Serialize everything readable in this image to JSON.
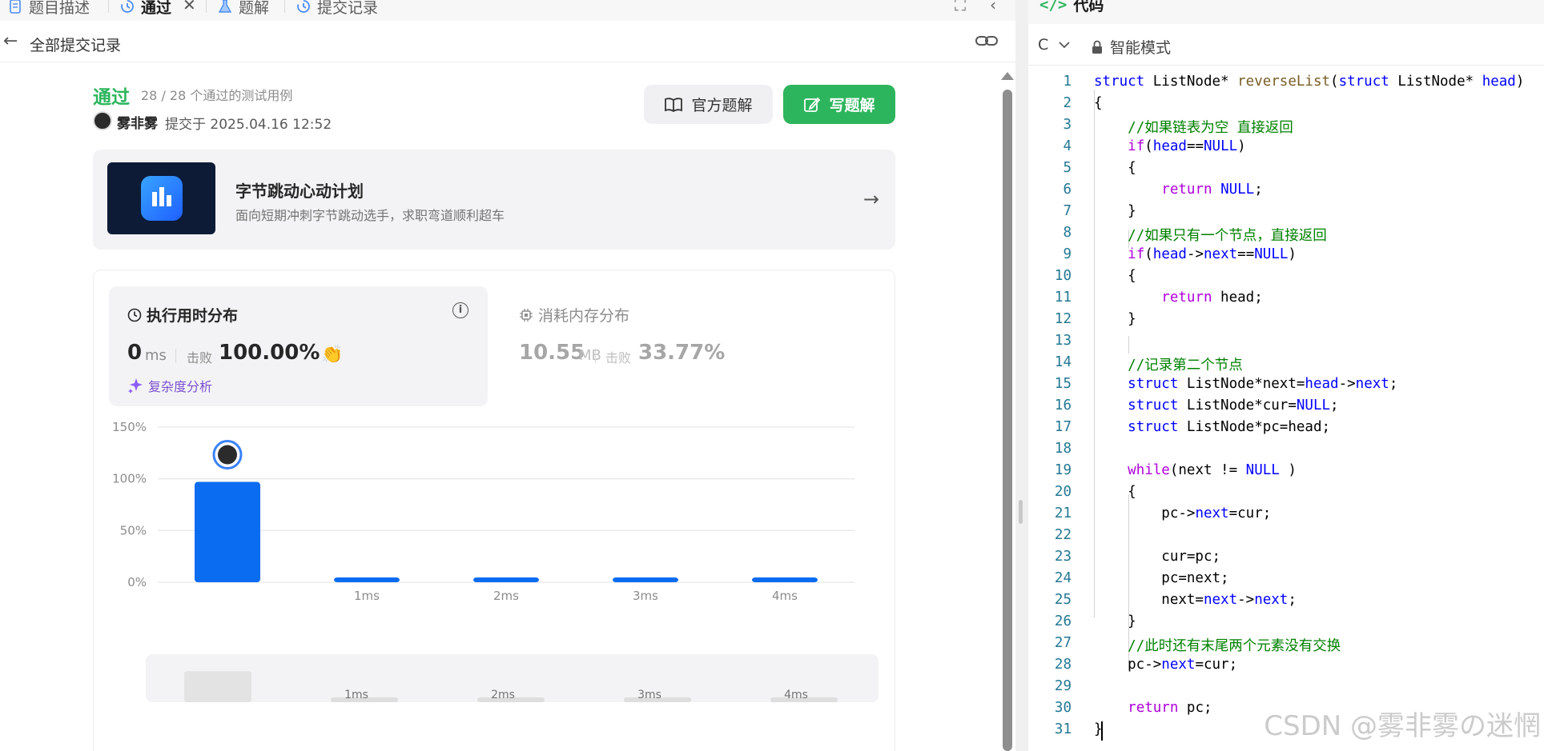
{
  "tabs": [
    {
      "label": "题目描述"
    },
    {
      "label": "通过"
    },
    {
      "label": "题解"
    },
    {
      "label": "提交记录"
    }
  ],
  "subheader": {
    "title": "全部提交记录"
  },
  "submission": {
    "status": "通过",
    "cases": "28 / 28 个通过的测试用例",
    "username": "雾非雾",
    "time": "提交于 2025.04.16 12:52"
  },
  "buttons": {
    "official": "官方题解",
    "write": "写题解"
  },
  "promo": {
    "title": "字节跳动心动计划",
    "subtitle": "面向短期冲刺字节跳动选手，求职弯道顺利超车"
  },
  "runtime": {
    "title": "执行用时分布",
    "value": "0",
    "unit": "ms",
    "beat_label": "击败",
    "beat_value": "100.00%",
    "complexity": "复杂度分析"
  },
  "memory": {
    "title": "消耗内存分布",
    "value": "10.55",
    "unit": "MB",
    "beat_label": "击败",
    "beat_value": "33.77%"
  },
  "chart_data": {
    "type": "bar",
    "categories": [
      "",
      "1ms",
      "2ms",
      "3ms",
      "4ms"
    ],
    "values": [
      97,
      4,
      4,
      4,
      4
    ],
    "yticks": [
      "0%",
      "50%",
      "100%",
      "150%"
    ],
    "ylim": [
      0,
      150
    ],
    "bar_color": "#0a6cf0",
    "grid": true
  },
  "minimap": {
    "labels": [
      "1ms",
      "2ms",
      "3ms",
      "4ms"
    ]
  },
  "code_panel": {
    "tab": "代码",
    "lang": "C",
    "mode": "智能模式",
    "watermark": "CSDN @雾非雾の迷惘"
  },
  "code_lines": [
    "1",
    "2",
    "3",
    "4",
    "5",
    "6",
    "7",
    "8",
    "9",
    "10",
    "11",
    "12",
    "13",
    "14",
    "15",
    "16",
    "17",
    "18",
    "19",
    "20",
    "21",
    "22",
    "23",
    "24",
    "25",
    "26",
    "27",
    "28",
    "29",
    "30",
    "31"
  ]
}
